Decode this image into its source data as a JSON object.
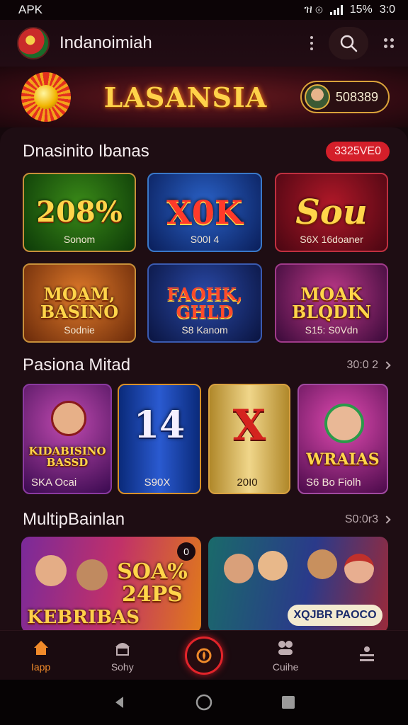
{
  "status_bar": {
    "carrier": "APK",
    "icons_text": "ዝ ⊚",
    "battery": "15%",
    "time": "3:0"
  },
  "app_bar": {
    "title": "Indanoimiah"
  },
  "banner": {
    "brand": "LASANSIA",
    "coins": "508389"
  },
  "section1": {
    "title": "Dnasinito Ibanas",
    "badge": "3325VE0",
    "cards": [
      {
        "title": "208%",
        "subtitle": "Sonom"
      },
      {
        "title": "X0K",
        "subtitle": "S00I 4"
      },
      {
        "title": "Sou",
        "subtitle": "S6X 16doaner"
      },
      {
        "title": "MOAM, BASINO",
        "subtitle": "Sodnie"
      },
      {
        "title": "FAOHK, GHLD",
        "subtitle": "S8 Kanom"
      },
      {
        "title": "MOAK BLQDIN",
        "subtitle": "S15: S0Vdn"
      }
    ]
  },
  "section2": {
    "title": "Pasiona Mitad",
    "see_all": "30:0 2",
    "tiles": [
      {
        "art": "KIDABISINO BASSD",
        "caption": "SKA Ocai"
      },
      {
        "art": "14",
        "caption": "S90X"
      },
      {
        "art": "X",
        "caption": "20I0"
      },
      {
        "art": "WRAIAS",
        "caption": "S6 Bo Fiolh"
      }
    ]
  },
  "section3": {
    "title": "MultipBainlan",
    "see_all": "S0:0r3",
    "banners": [
      {
        "title": "KEBRIBAS",
        "promo": "SOA% 24PS",
        "counter": "0"
      },
      {
        "title": "XQJBR PAOCO"
      }
    ]
  },
  "bottom_nav": [
    {
      "label": "Iapp"
    },
    {
      "label": "Sohy"
    },
    {
      "label": ""
    },
    {
      "label": "Cuihe"
    },
    {
      "label": ""
    }
  ],
  "colors": {
    "accent": "#f08a2a",
    "badge": "#d41f2a",
    "gold": "#ffd24a"
  }
}
